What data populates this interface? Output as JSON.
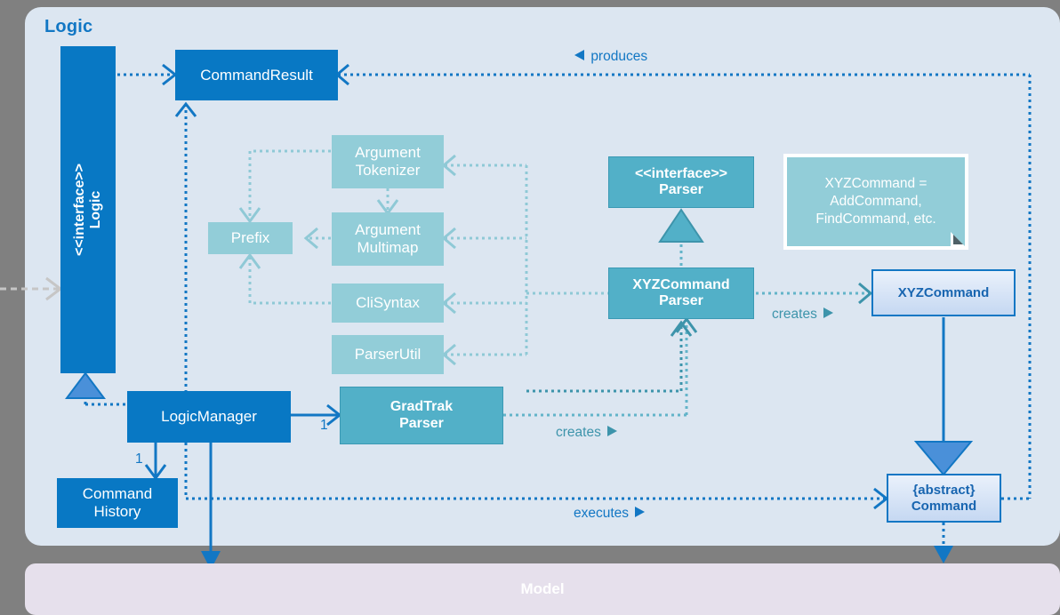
{
  "diagram": {
    "type": "uml-class-diagram",
    "title": "Logic component class diagram",
    "packages": [
      {
        "name": "Logic",
        "label": "Logic"
      },
      {
        "name": "Model",
        "label": "Model"
      }
    ],
    "colors": {
      "background": "#808080",
      "logic_panel": "#dce6f1",
      "model_panel": "#e6e0ec",
      "dark_blue": "#0878c4",
      "teal": "#52b0c8",
      "light_teal": "#92cdd8",
      "accent_text": "#1277c4",
      "gradient_box_border": "#1277c4"
    },
    "nodes": {
      "logic_interface": {
        "stereotype": "<<interface>>",
        "name": "Logic"
      },
      "command_result": {
        "name": "CommandResult"
      },
      "argument_tokenizer": {
        "line1": "Argument",
        "line2": "Tokenizer"
      },
      "argument_multimap": {
        "line1": "Argument",
        "line2": "Multimap"
      },
      "prefix": {
        "name": "Prefix"
      },
      "cli_syntax": {
        "name": "CliSyntax"
      },
      "parser_util": {
        "name": "ParserUtil"
      },
      "parser_interface": {
        "stereotype": "<<interface>>",
        "name": "Parser"
      },
      "xyz_command_parser": {
        "line1": "XYZCommand",
        "line2": "Parser"
      },
      "xyz_command": {
        "name": "XYZCommand"
      },
      "logic_manager": {
        "name": "LogicManager"
      },
      "gradtrak_parser": {
        "line1": "GradTrak",
        "line2": "Parser"
      },
      "command_history": {
        "line1": "Command",
        "line2": "History"
      },
      "abstract_command": {
        "line1": "{abstract}",
        "line2": "Command"
      }
    },
    "note": {
      "line1": "XYZCommand =",
      "line2": "AddCommand,",
      "line3": "FindCommand, etc."
    },
    "edge_labels": {
      "produces": "produces",
      "creates_parser": "creates",
      "creates_gradtrak": "creates",
      "executes": "executes"
    },
    "multiplicities": {
      "gradtrak_parser": "1",
      "command_history": "1"
    }
  }
}
